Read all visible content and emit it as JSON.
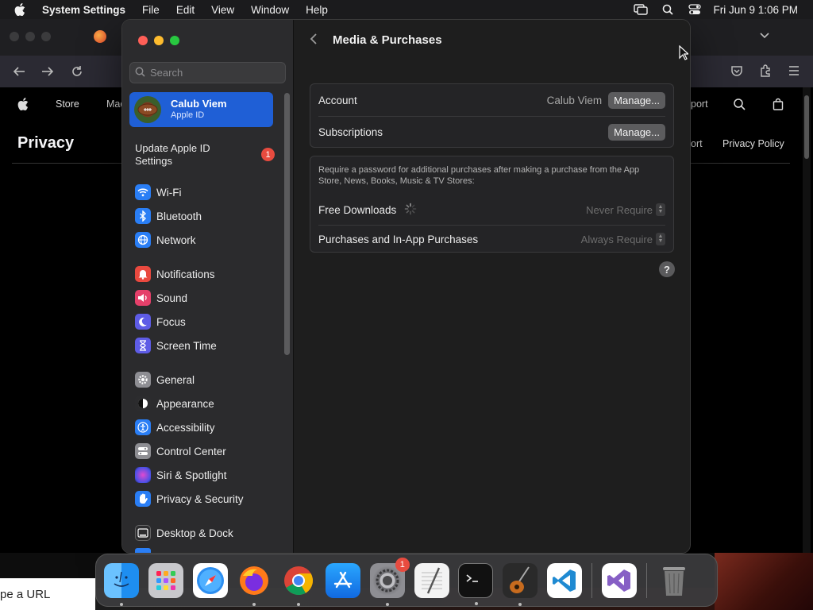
{
  "menubar": {
    "app_name": "System Settings",
    "menus": [
      "File",
      "Edit",
      "View",
      "Window",
      "Help"
    ],
    "clock": "Fri Jun 9  1:06 PM"
  },
  "browser": {
    "nav_links": [
      "Store",
      "Mac"
    ],
    "nav_right": [
      "port"
    ],
    "page_heading": "Privacy",
    "subnav": [
      "ort",
      "Privacy Policy"
    ]
  },
  "settings": {
    "search_placeholder": "Search",
    "account": {
      "name": "Calub Viem",
      "subtitle": "Apple ID"
    },
    "update": {
      "label": "Update Apple ID Settings",
      "badge": "1"
    },
    "groups": [
      [
        {
          "label": "Wi-Fi",
          "icon": "wifi-icon",
          "color": "#2a7ef5"
        },
        {
          "label": "Bluetooth",
          "icon": "bluetooth-icon",
          "color": "#2a7ef5"
        },
        {
          "label": "Network",
          "icon": "globe-icon",
          "color": "#2a7ef5"
        }
      ],
      [
        {
          "label": "Notifications",
          "icon": "bell-icon",
          "color": "#e9493f"
        },
        {
          "label": "Sound",
          "icon": "speaker-icon",
          "color": "#e5406a"
        },
        {
          "label": "Focus",
          "icon": "moon-icon",
          "color": "#5e5ce6"
        },
        {
          "label": "Screen Time",
          "icon": "hourglass-icon",
          "color": "#5e5ce6"
        }
      ],
      [
        {
          "label": "General",
          "icon": "gear-icon",
          "color": "#8e8e93"
        },
        {
          "label": "Appearance",
          "icon": "appearance-icon",
          "color": "#2c2c2e"
        },
        {
          "label": "Accessibility",
          "icon": "accessibility-icon",
          "color": "#2a7ef5"
        },
        {
          "label": "Control Center",
          "icon": "control-center-icon",
          "color": "#8e8e93"
        },
        {
          "label": "Siri & Spotlight",
          "icon": "siri-icon",
          "color": "#b04ad6"
        },
        {
          "label": "Privacy & Security",
          "icon": "hand-icon",
          "color": "#2a7ef5"
        }
      ],
      [
        {
          "label": "Desktop & Dock",
          "icon": "dock-icon",
          "color": "#2c2c2e"
        }
      ]
    ],
    "content": {
      "title": "Media & Purchases",
      "account_label": "Account",
      "account_value": "Calub Viem",
      "manage_label": "Manage...",
      "subscriptions_label": "Subscriptions",
      "subscriptions_manage_label": "Manage...",
      "note": "Require a password for additional purchases after making a purchase from the App Store, News, Books, Music & TV Stores:",
      "free_downloads_label": "Free Downloads",
      "free_downloads_value": "Never Require",
      "purchases_label": "Purchases and In-App Purchases",
      "purchases_value": "Always Require",
      "help": "?"
    }
  },
  "dock": {
    "apps": [
      {
        "name": "Finder",
        "color": "#1e8ef0"
      },
      {
        "name": "Launchpad",
        "color": "#c8c8cc"
      },
      {
        "name": "Safari",
        "color": "#ffffff"
      },
      {
        "name": "Firefox",
        "color": "#ff7a1a"
      },
      {
        "name": "Chrome",
        "color": "#ffffff"
      },
      {
        "name": "App Store",
        "color": "#1c8cf3"
      },
      {
        "name": "System Settings",
        "color": "#8e8e93",
        "badge": "1"
      },
      {
        "name": "TextEdit",
        "color": "#f3f3f3"
      },
      {
        "name": "Terminal",
        "color": "#111111"
      },
      {
        "name": "GarageBand",
        "color": "#333333"
      },
      {
        "name": "Visual Studio Code",
        "color": "#ffffff"
      },
      {
        "name": "Visual Studio",
        "color": "#ffffff"
      },
      {
        "name": "Trash",
        "color": "#6a6a6a"
      }
    ]
  },
  "url_fragment": "pe a URL"
}
